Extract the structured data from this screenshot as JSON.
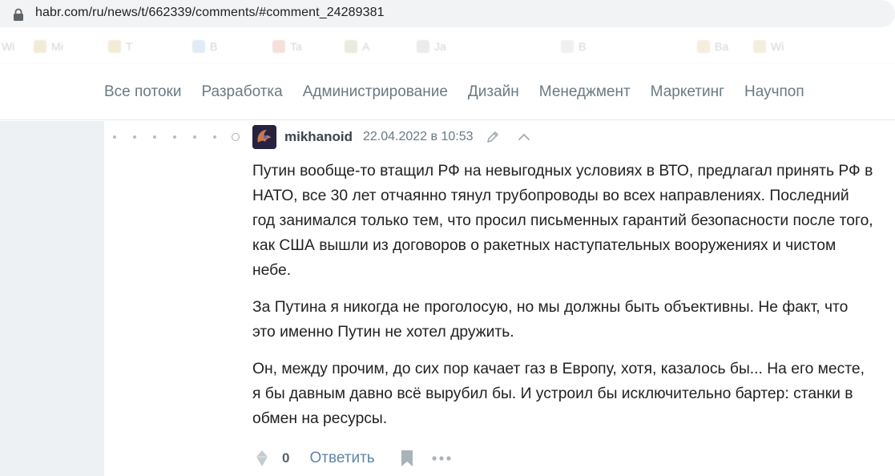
{
  "browser": {
    "url": "habr.com/ru/news/t/662339/comments/#comment_24289381",
    "bookmarks": [
      "Wi",
      "Mi",
      "T",
      "B",
      "Ta",
      "A",
      "Ja",
      "B",
      "Ba",
      "Wi"
    ]
  },
  "nav": {
    "items": [
      "Все потоки",
      "Разработка",
      "Администрирование",
      "Дизайн",
      "Менеджмент",
      "Маркетинг",
      "Научпоп"
    ]
  },
  "comment": {
    "author": "mikhanoid",
    "timestamp": "22.04.2022 в 10:53",
    "paragraphs": [
      "Путин вообще-то втащил РФ на невыгодных условиях в ВТО, предлагал принять РФ в НАТО, все 30 лет отчаянно тянул трубопроводы во всех направлениях. Последний год занимался только тем, что просил письменных гарантий безопасности после того, как США вышли из договоров о ракетных наступательных вооружениях и чистом небе.",
      "За Путина я никогда не проголосую, но мы должны быть объективны. Не факт, что это именно Путин не хотел дружить.",
      "Он, между прочим, до сих пор качает газ в Европу, хотя, казалось бы... На его месте, я бы давным давно всё вырубил бы. И устроил бы исключительно бартер: станки в обмен на ресурсы."
    ],
    "score": "0",
    "reply_label": "Ответить"
  },
  "colors": {
    "nav_text": "#6a7a83",
    "reply_link": "#5e85a6",
    "page_bg": "#eef1f3"
  }
}
